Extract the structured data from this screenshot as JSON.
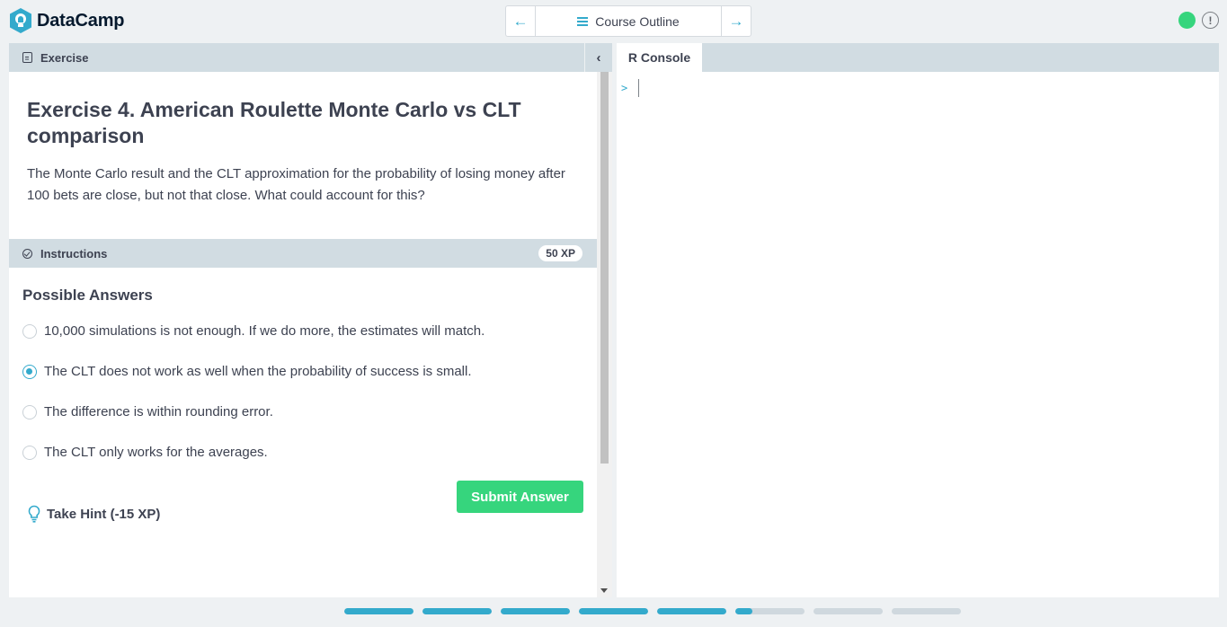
{
  "brand": {
    "name": "DataCamp"
  },
  "nav": {
    "center_label": "Course Outline"
  },
  "exercise": {
    "tab_label": "Exercise",
    "title": "Exercise 4. American Roulette Monte Carlo vs CLT comparison",
    "description": "The Monte Carlo result and the CLT approximation for the probability of losing money after 100 bets are close, but not that close. What could account for this?"
  },
  "instructions": {
    "label": "Instructions",
    "xp": "50 XP",
    "answers_title": "Possible Answers",
    "answers": [
      {
        "text": "10,000 simulations is not enough. If we do more, the estimates will match.",
        "selected": false
      },
      {
        "text": "The CLT does not work as well when the probability of success is small.",
        "selected": true
      },
      {
        "text": "The difference is within rounding error.",
        "selected": false
      },
      {
        "text": "The CLT only works for the averages.",
        "selected": false
      }
    ],
    "submit_label": "Submit Answer",
    "hint_label": "Take Hint (-15 XP)"
  },
  "console": {
    "tab_label": "R Console",
    "prompt": ">"
  },
  "progress": {
    "segments": [
      1,
      1,
      1,
      1,
      1,
      0.25,
      0,
      0
    ]
  },
  "colors": {
    "accent": "#33aacc",
    "success": "#36d57d",
    "panel_header": "#d1dce2"
  }
}
